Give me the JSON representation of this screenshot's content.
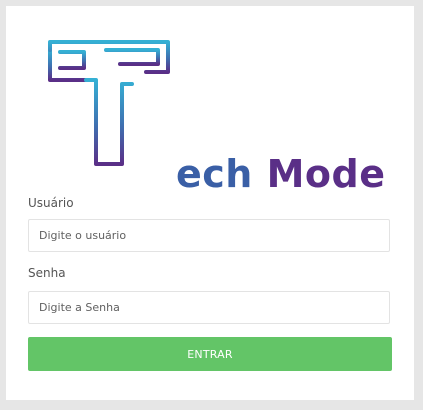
{
  "brand": {
    "logo_text_part1": "ech",
    "logo_text_part2": "Mode"
  },
  "form": {
    "username_label": "Usuário",
    "username_placeholder": "Digite o usuário",
    "username_value": "",
    "password_label": "Senha",
    "password_placeholder": "Digite a Senha",
    "password_value": "",
    "submit_label": "ENTRAR"
  },
  "colors": {
    "page_background": "#e6e6e6",
    "card_background": "#ffffff",
    "logo_gradient_top": "#35b0d4",
    "logo_gradient_bottom": "#5a2f87",
    "button": "#63c567"
  }
}
